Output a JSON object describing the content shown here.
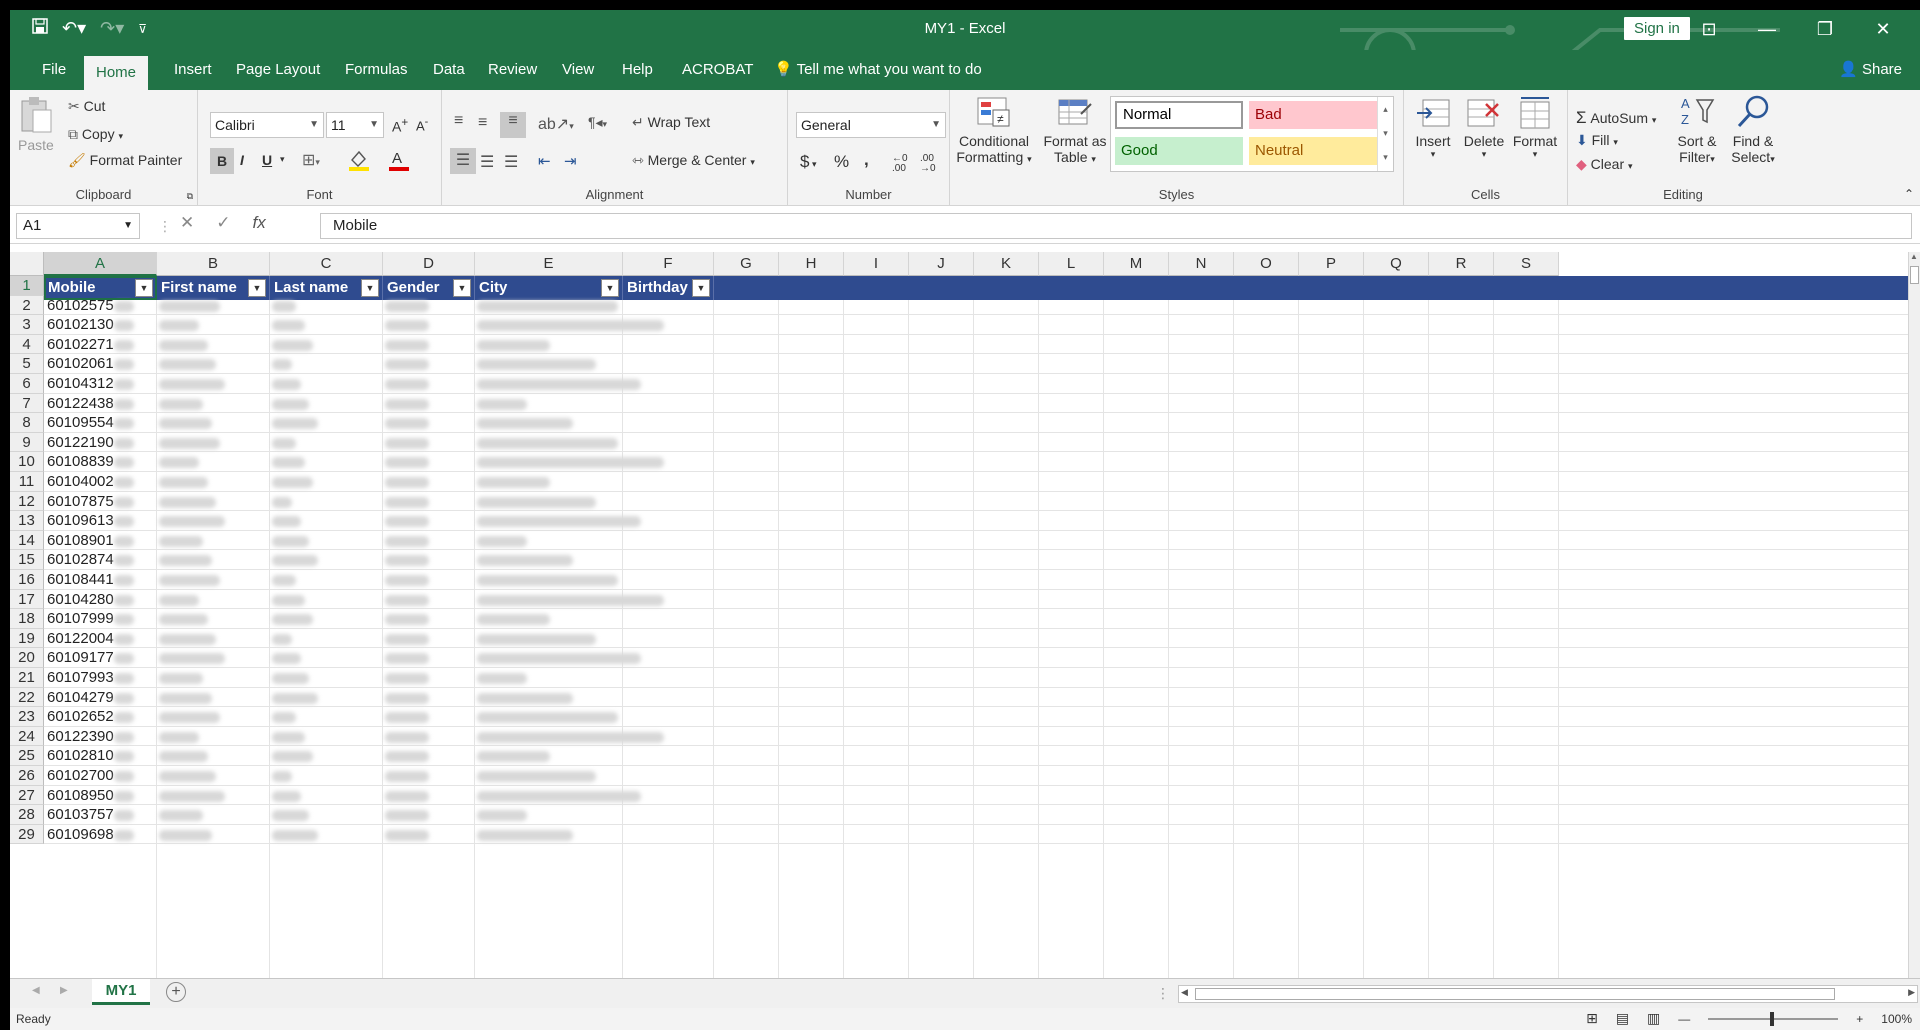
{
  "window": {
    "title": "MY1  -  Excel",
    "sign_in": "Sign in"
  },
  "tabs": [
    {
      "label": "File"
    },
    {
      "label": "Home"
    },
    {
      "label": "Insert"
    },
    {
      "label": "Page Layout"
    },
    {
      "label": "Formulas"
    },
    {
      "label": "Data"
    },
    {
      "label": "Review"
    },
    {
      "label": "View"
    },
    {
      "label": "Help"
    },
    {
      "label": "ACROBAT"
    },
    {
      "label": "Tell me what you want to do"
    }
  ],
  "share_label": "Share",
  "ribbon": {
    "clipboard": {
      "label": "Clipboard",
      "paste": "Paste",
      "cut": "Cut",
      "copy": "Copy",
      "format_painter": "Format Painter"
    },
    "font": {
      "label": "Font",
      "family": "Calibri",
      "size": "11",
      "bold": "B",
      "italic": "I",
      "underline": "U"
    },
    "alignment": {
      "label": "Alignment",
      "wrap_text": "Wrap Text",
      "merge_center": "Merge & Center"
    },
    "number": {
      "label": "Number",
      "format": "General",
      "currency": "$",
      "percent": "%",
      "comma": ","
    },
    "styles": {
      "label": "Styles",
      "conditional": "Conditional",
      "formatting": "Formatting",
      "format_as": "Format as",
      "table": "Table",
      "normal": "Normal",
      "bad": "Bad",
      "good": "Good",
      "neutral": "Neutral"
    },
    "cells": {
      "label": "Cells",
      "insert": "Insert",
      "delete": "Delete",
      "format": "Format"
    },
    "editing": {
      "label": "Editing",
      "autosum": "AutoSum",
      "fill": "Fill",
      "clear": "Clear",
      "sort": "Sort &",
      "filter": "Filter",
      "find": "Find &",
      "select": "Select"
    }
  },
  "formula_bar": {
    "name_box": "A1",
    "formula": "Mobile"
  },
  "columns": [
    "A",
    "B",
    "C",
    "D",
    "E",
    "F",
    "G",
    "H",
    "I",
    "J",
    "K",
    "L",
    "M",
    "N",
    "O",
    "P",
    "Q",
    "R",
    "S"
  ],
  "table_headers": [
    "Mobile",
    "First name",
    "Last name",
    "Gender",
    "City",
    "Birthday"
  ],
  "rows": [
    {
      "num": "1"
    },
    {
      "num": "2",
      "mobile": "60102575"
    },
    {
      "num": "3",
      "mobile": "60102130"
    },
    {
      "num": "4",
      "mobile": "60102271"
    },
    {
      "num": "5",
      "mobile": "60102061"
    },
    {
      "num": "6",
      "mobile": "60104312"
    },
    {
      "num": "7",
      "mobile": "60122438"
    },
    {
      "num": "8",
      "mobile": "60109554"
    },
    {
      "num": "9",
      "mobile": "60122190"
    },
    {
      "num": "10",
      "mobile": "60108839"
    },
    {
      "num": "11",
      "mobile": "60104002"
    },
    {
      "num": "12",
      "mobile": "60107875"
    },
    {
      "num": "13",
      "mobile": "60109613"
    },
    {
      "num": "14",
      "mobile": "60108901"
    },
    {
      "num": "15",
      "mobile": "60102874"
    },
    {
      "num": "16",
      "mobile": "60108441"
    },
    {
      "num": "17",
      "mobile": "60104280"
    },
    {
      "num": "18",
      "mobile": "60107999"
    },
    {
      "num": "19",
      "mobile": "60122004"
    },
    {
      "num": "20",
      "mobile": "60109177"
    },
    {
      "num": "21",
      "mobile": "60107993"
    },
    {
      "num": "22",
      "mobile": "60104279"
    },
    {
      "num": "23",
      "mobile": "60102652"
    },
    {
      "num": "24",
      "mobile": "60122390"
    },
    {
      "num": "25",
      "mobile": "60102810"
    },
    {
      "num": "26",
      "mobile": "60102700"
    },
    {
      "num": "27",
      "mobile": "60108950"
    },
    {
      "num": "28",
      "mobile": "60103757"
    },
    {
      "num": "29",
      "mobile": "60109698"
    }
  ],
  "sheet_tab": "MY1",
  "status": {
    "ready": "Ready",
    "zoom": "100%"
  },
  "colors": {
    "excel_green": "#217346",
    "table_header": "#2f4b8f"
  }
}
